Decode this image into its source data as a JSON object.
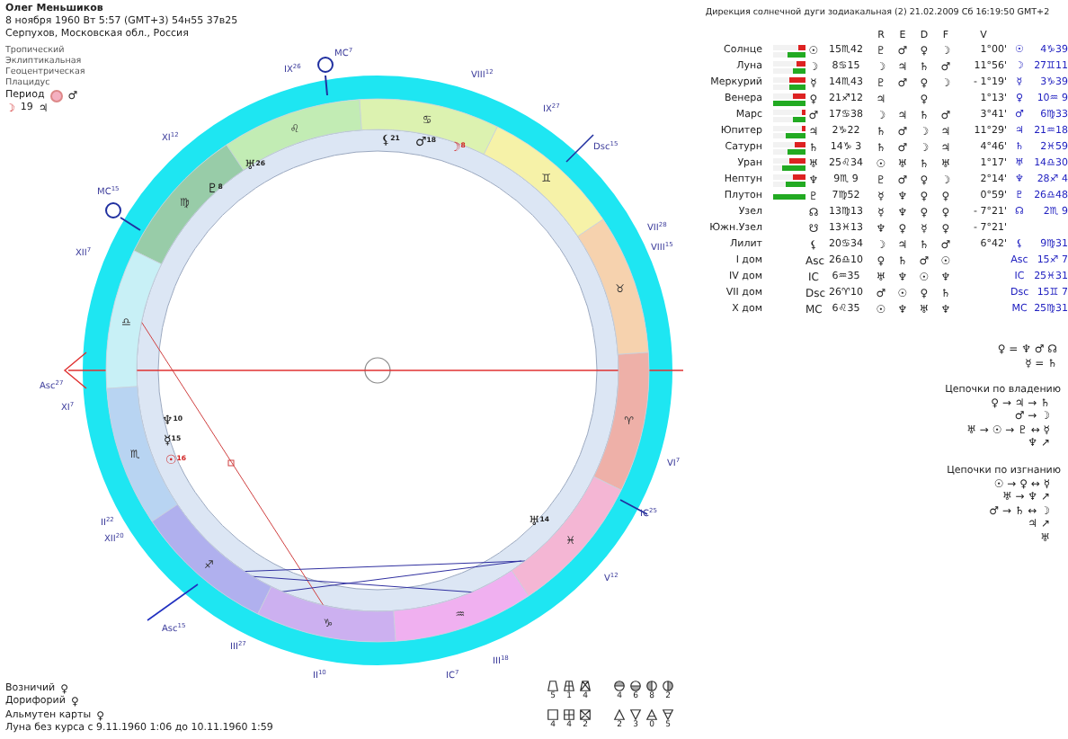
{
  "person": {
    "name": "Олег Меньшиков",
    "birth": "8 ноября 1960  Вт   5:57 (GMT+3) 54н55  37в25",
    "place": "Серпухов, Московская обл., Россия"
  },
  "settings": [
    "Тропический",
    "Эклиптикальная",
    "Геоцентрическая",
    "Плацидус"
  ],
  "period": {
    "label": "Период",
    "ruler": "♂",
    "moon": "☽",
    "day": "19",
    "planet": "♃"
  },
  "zodiac": [
    {
      "glyph": "♈",
      "color": "#eeb0a8"
    },
    {
      "glyph": "♉",
      "color": "#f6d2ae"
    },
    {
      "glyph": "♊",
      "color": "#f6f2a8"
    },
    {
      "glyph": "♋",
      "color": "#dcf2b0"
    },
    {
      "glyph": "♌",
      "color": "#c2ecb4"
    },
    {
      "glyph": "♍",
      "color": "#98cca8"
    },
    {
      "glyph": "♎",
      "color": "#c8f0f6"
    },
    {
      "glyph": "♏",
      "color": "#b8d4f2"
    },
    {
      "glyph": "♐",
      "color": "#b0b0ee"
    },
    {
      "glyph": "♑",
      "color": "#ccb0f0"
    },
    {
      "glyph": "♒",
      "color": "#f0b0f0"
    },
    {
      "glyph": "♓",
      "color": "#f4b6d4"
    }
  ],
  "house_labels": [
    {
      "text": "IX",
      "sup": "26"
    },
    {
      "text": "MC",
      "sup": "7"
    },
    {
      "text": "VIII",
      "sup": "12"
    },
    {
      "text": "IX",
      "sup": "27"
    },
    {
      "text": "Dsc",
      "sup": "15"
    },
    {
      "text": "VII",
      "sup": "28"
    },
    {
      "text": "VIII",
      "sup": "15"
    },
    {
      "text": "VI",
      "sup": "7"
    },
    {
      "text": "IC",
      "sup": "25"
    },
    {
      "text": "V",
      "sup": "12"
    },
    {
      "text": "III",
      "sup": "18"
    },
    {
      "text": "IC",
      "sup": "7"
    },
    {
      "text": "II",
      "sup": "10"
    },
    {
      "text": "III",
      "sup": "27"
    },
    {
      "text": "Asc",
      "sup": "15"
    },
    {
      "text": "II",
      "sup": "22"
    },
    {
      "text": "XII",
      "sup": "20"
    },
    {
      "text": "XI",
      "sup": "7"
    },
    {
      "text": "Asc",
      "sup": "27"
    },
    {
      "text": "XII",
      "sup": "7"
    },
    {
      "text": "MC",
      "sup": "15"
    },
    {
      "text": "XI",
      "sup": "12"
    }
  ],
  "wheel_planets": [
    {
      "glyph": "⚸",
      "sup": "21",
      "color": "#202020"
    },
    {
      "glyph": "♂",
      "sup": "18",
      "color": "#202020"
    },
    {
      "glyph": "☽",
      "sup": "8",
      "color": "#d02020"
    },
    {
      "glyph": "♅",
      "sup": "26",
      "color": "#202020"
    },
    {
      "glyph": "♇",
      "sup": "8",
      "color": "#202020"
    },
    {
      "glyph": "♆",
      "sup": "10",
      "color": "#202020"
    },
    {
      "glyph": "☿",
      "sup": "15",
      "color": "#202020"
    },
    {
      "glyph": "☉",
      "sup": "16",
      "color": "#d02020"
    },
    {
      "glyph": "♅",
      "sup": "14",
      "color": "#202020"
    }
  ],
  "direction_title": "Дирекция солнечной дуги зодиакальная (2) 21.02.2009  Сб 16:19:50 GMT+2",
  "table": {
    "columns": [
      "R",
      "E",
      "D",
      "F",
      "V"
    ],
    "rows": [
      {
        "name": "Солнце",
        "bars": [
          {
            "level": 0.2,
            "color": "#dd2222"
          },
          {
            "level": 0.55,
            "color": "#22aa22"
          }
        ],
        "glyph": "☉",
        "position": "15♏42",
        "rulers": {
          "r": "♇",
          "e": "♂",
          "d": "♀",
          "f": "☽"
        },
        "v": "1°00'",
        "directed_glyph": "☉",
        "directed_position": "4♑39"
      },
      {
        "name": "Луна",
        "bars": [
          {
            "level": 0.3,
            "color": "#dd2222"
          },
          {
            "level": 0.4,
            "color": "#22aa22"
          }
        ],
        "glyph": "☽",
        "position": "8♋15",
        "rulers": {
          "r": "☽",
          "e": "♃",
          "d": "♄",
          "f": "♂"
        },
        "v": "11°56'",
        "directed_glyph": "☽",
        "directed_position": "27♊11"
      },
      {
        "name": "Меркурий",
        "bars": [
          {
            "level": 0.5,
            "color": "#dd2222"
          },
          {
            "level": 0.5,
            "color": "#22aa22"
          }
        ],
        "glyph": "☿",
        "position": "14♏43",
        "rulers": {
          "r": "♇",
          "e": "♂",
          "d": "♀",
          "f": "☽"
        },
        "v": "- 1°19'",
        "directed_glyph": "☿",
        "directed_position": "3♑39"
      },
      {
        "name": "Венера",
        "bars": [
          {
            "level": 0.4,
            "color": "#dd2222"
          },
          {
            "level": 1,
            "color": "#22aa22"
          }
        ],
        "glyph": "♀",
        "position": "21♐12",
        "rulers": {
          "r": "♃",
          "d": "♀"
        },
        "v": "1°13'",
        "directed_glyph": "♀",
        "directed_position": "10♒ 9"
      },
      {
        "name": "Марс",
        "bars": [
          {
            "level": 0.1,
            "color": "#dd2222"
          },
          {
            "level": 0.4,
            "color": "#22aa22"
          }
        ],
        "glyph": "♂",
        "position": "17♋38",
        "rulers": {
          "r": "☽",
          "e": "♃",
          "d": "♄",
          "f": "♂"
        },
        "v": "3°41'",
        "directed_glyph": "♂",
        "directed_position": "6♍33"
      },
      {
        "name": "Юпитер",
        "bars": [
          {
            "level": 0.1,
            "color": "#dd2222"
          },
          {
            "level": 0.6,
            "color": "#22aa22"
          }
        ],
        "glyph": "♃",
        "position": "2♑22",
        "rulers": {
          "r": "♄",
          "e": "♂",
          "d": "☽",
          "f": "♃"
        },
        "v": "11°29'",
        "directed_glyph": "♃",
        "directed_position": "21♒18"
      },
      {
        "name": "Сатурн",
        "bars": [
          {
            "level": 0.35,
            "color": "#dd2222"
          },
          {
            "level": 0.55,
            "color": "#22aa22"
          }
        ],
        "glyph": "♄",
        "position": "14♑ 3",
        "rulers": {
          "r": "♄",
          "e": "♂",
          "d": "☽",
          "f": "♃"
        },
        "v": "4°46'",
        "directed_glyph": "♄",
        "directed_position": "2♓59"
      },
      {
        "name": "Уран",
        "bars": [
          {
            "level": 0.5,
            "color": "#dd2222"
          },
          {
            "level": 0.7,
            "color": "#22aa22"
          }
        ],
        "glyph": "♅",
        "position": "25♌34",
        "rulers": {
          "r": "☉",
          "e": "♅",
          "d": "♄",
          "f": "♅"
        },
        "v": "1°17'",
        "directed_glyph": "♅",
        "directed_position": "14♎30"
      },
      {
        "name": "Нептун",
        "bars": [
          {
            "level": 0.4,
            "color": "#dd2222"
          },
          {
            "level": 0.6,
            "color": "#22aa22"
          }
        ],
        "glyph": "♆",
        "position": "9♏ 9",
        "rulers": {
          "r": "♇",
          "e": "♂",
          "d": "♀",
          "f": "☽"
        },
        "v": "2°14'",
        "directed_glyph": "♆",
        "directed_position": "28♐ 4"
      },
      {
        "name": "Плутон",
        "bars": [
          {
            "level": 1,
            "color": "#22aa22"
          }
        ],
        "glyph": "♇",
        "position": "7♍52",
        "rulers": {
          "r": "☿",
          "e": "♆",
          "d": "♀",
          "f": "♀"
        },
        "v": "0°59'",
        "directed_glyph": "♇",
        "directed_position": "26♎48"
      },
      {
        "name": "Узел",
        "glyph": "☊",
        "position": "13♍13",
        "rulers": {
          "r": "☿",
          "e": "♆",
          "d": "♀",
          "f": "♀"
        },
        "v": "- 7°21'",
        "directed_glyph": "☊",
        "directed_position": "2♏ 9"
      },
      {
        "name": "Южн.Узел",
        "glyph": "☋",
        "position": "13♓13",
        "rulers": {
          "r": "♆",
          "e": "♀",
          "d": "☿",
          "f": "♀"
        },
        "v": "- 7°21'"
      },
      {
        "name": "Лилит",
        "glyph": "⚸",
        "position": "20♋34",
        "rulers": {
          "r": "☽",
          "e": "♃",
          "d": "♄",
          "f": "♂"
        },
        "v": "6°42'",
        "directed_glyph": "⚸",
        "directed_position": "9♍31"
      },
      {
        "name": "I дом",
        "glyph": "Asc",
        "position": "26♎10",
        "rulers": {
          "r": "♀",
          "e": "♄",
          "d": "♂",
          "f": "☉"
        },
        "directed_glyph": "Asc",
        "directed_position": "15♐ 7"
      },
      {
        "name": "IV дом",
        "glyph": "IC",
        "position": "6♒35",
        "rulers": {
          "r": "♅",
          "e": "♆",
          "d": "☉",
          "f": "♆"
        },
        "directed_glyph": "IC",
        "directed_position": "25♓31"
      },
      {
        "name": "VII дом",
        "glyph": "Dsc",
        "position": "26♈10",
        "rulers": {
          "r": "♂",
          "e": "☉",
          "d": "♀",
          "f": "♄"
        },
        "directed_glyph": "Dsc",
        "directed_position": "15♊ 7"
      },
      {
        "name": "X дом",
        "glyph": "MC",
        "position": "6♌35",
        "rulers": {
          "r": "☉",
          "e": "♆",
          "d": "♅",
          "f": "♆"
        },
        "directed_glyph": "MC",
        "directed_position": "25♍31"
      }
    ]
  },
  "equalities": [
    "♀ = ♆ ♂ ☊",
    "☿ = ♄"
  ],
  "chains": [
    {
      "title": "Цепочки по владению",
      "lines": [
        "♀ → ♃ → ♄",
        "♂ → ☽",
        "♅ → ☉ → ♇ ↔ ☿",
        "♆ ↗"
      ]
    },
    {
      "title": "Цепочки по изгнанию",
      "lines": [
        "☉ → ♀ ↔ ☿",
        "♅ → ♆ ↗",
        "♂ → ♄ ↔ ☽",
        "♃ ↗",
        "♅"
      ]
    }
  ],
  "notes": [
    {
      "label": "Возничий",
      "value": "♀"
    },
    {
      "label": "Дорифорий",
      "value": "♀"
    },
    {
      "label": "Альмутен карты",
      "value": "♀"
    },
    {
      "label": "Луна без курса с 9.11.1960  1:06 до 10.11.1960  1:59"
    }
  ],
  "counts_top": [
    {
      "kind": "trapezoid",
      "count": "5"
    },
    {
      "kind": "window",
      "count": "1"
    },
    {
      "kind": "trapezoid-cross",
      "count": "4"
    },
    {
      "kind": "circle-top",
      "count": "4"
    },
    {
      "kind": "circle-bottom",
      "count": "6"
    },
    {
      "kind": "circle-left",
      "count": "8"
    },
    {
      "kind": "circle-right",
      "count": "2"
    }
  ],
  "counts_bottom": [
    {
      "kind": "square",
      "count": "4"
    },
    {
      "kind": "square-cross",
      "count": "4"
    },
    {
      "kind": "square-x",
      "count": "2"
    },
    {
      "kind": "triangle-up",
      "count": "2"
    },
    {
      "kind": "triangle-down",
      "count": "3"
    },
    {
      "kind": "triangle-bar-up",
      "count": "0"
    },
    {
      "kind": "triangle-bar-down",
      "count": "5"
    }
  ]
}
